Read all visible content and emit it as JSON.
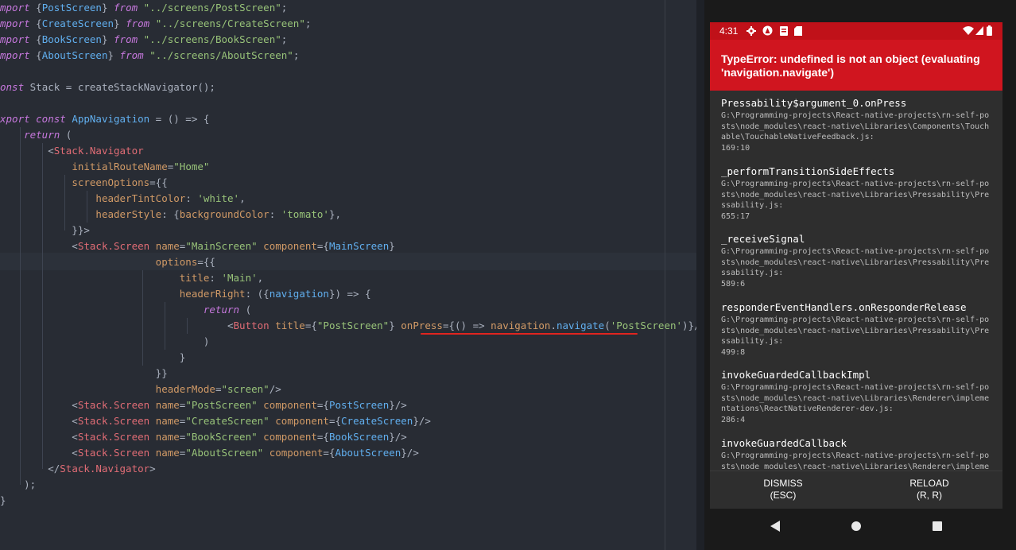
{
  "editor": {
    "lines": [
      [
        [
          "mport ",
          "kw"
        ],
        [
          "{",
          "br"
        ],
        [
          "PostScreen",
          "cl"
        ],
        [
          "} ",
          "br"
        ],
        [
          "from ",
          "kw"
        ],
        [
          "\"../screens/PostScreen\"",
          "str"
        ],
        [
          ";",
          "plain"
        ]
      ],
      [
        [
          "mport ",
          "kw"
        ],
        [
          "{",
          "br"
        ],
        [
          "CreateScreen",
          "cl"
        ],
        [
          "} ",
          "br"
        ],
        [
          "from ",
          "kw"
        ],
        [
          "\"../screens/CreateScreen\"",
          "str"
        ],
        [
          ";",
          "plain"
        ]
      ],
      [
        [
          "mport ",
          "kw"
        ],
        [
          "{",
          "br"
        ],
        [
          "BookScreen",
          "cl"
        ],
        [
          "} ",
          "br"
        ],
        [
          "from ",
          "kw"
        ],
        [
          "\"../screens/BookScreen\"",
          "str"
        ],
        [
          ";",
          "plain"
        ]
      ],
      [
        [
          "mport ",
          "kw"
        ],
        [
          "{",
          "br"
        ],
        [
          "AboutScreen",
          "cl"
        ],
        [
          "} ",
          "br"
        ],
        [
          "from ",
          "kw"
        ],
        [
          "\"../screens/AboutScreen\"",
          "str"
        ],
        [
          ";",
          "plain"
        ]
      ],
      [],
      [
        [
          "onst ",
          "kw"
        ],
        [
          "Stack = createStackNavigator();",
          "plain"
        ]
      ],
      [],
      [
        [
          "xport ",
          "kw"
        ],
        [
          "const ",
          "kw"
        ],
        [
          "AppNavigation",
          "fn"
        ],
        [
          " = () => {",
          "plain"
        ]
      ],
      [
        [
          "    ",
          "plain"
        ],
        [
          "return ",
          "kw"
        ],
        [
          "(",
          "plain"
        ]
      ],
      [
        [
          "        <",
          "plain"
        ],
        [
          "Stack.Navigator",
          "tag"
        ]
      ],
      [
        [
          "            ",
          "plain"
        ],
        [
          "initialRouteName",
          "attr"
        ],
        [
          "=",
          "plain"
        ],
        [
          "\"Home\"",
          "str"
        ]
      ],
      [
        [
          "            ",
          "plain"
        ],
        [
          "screenOptions",
          "attr"
        ],
        [
          "={{",
          "plain"
        ]
      ],
      [
        [
          "                ",
          "plain"
        ],
        [
          "headerTintColor",
          "attr"
        ],
        [
          ": ",
          "plain"
        ],
        [
          "'white'",
          "str"
        ],
        [
          ",",
          "plain"
        ]
      ],
      [
        [
          "                ",
          "plain"
        ],
        [
          "headerStyle",
          "attr"
        ],
        [
          ": {",
          "plain"
        ],
        [
          "backgroundColor",
          "attr"
        ],
        [
          ": ",
          "plain"
        ],
        [
          "'tomato'",
          "str"
        ],
        [
          "},",
          "plain"
        ]
      ],
      [
        [
          "            }}>",
          "plain"
        ]
      ],
      [
        [
          "            <",
          "plain"
        ],
        [
          "Stack.Screen ",
          "tag"
        ],
        [
          "name",
          "attr"
        ],
        [
          "=",
          "plain"
        ],
        [
          "\"MainScreen\" ",
          "str"
        ],
        [
          "component",
          "attr"
        ],
        [
          "={",
          "plain"
        ],
        [
          "MainScreen",
          "cl"
        ],
        [
          "}",
          "plain"
        ]
      ],
      [
        [
          "                          ",
          "plain"
        ],
        [
          "options",
          "attr"
        ],
        [
          "={{",
          "plain"
        ]
      ],
      [
        [
          "                              ",
          "plain"
        ],
        [
          "title",
          "attr"
        ],
        [
          ": ",
          "plain"
        ],
        [
          "'Main'",
          "str"
        ],
        [
          ",",
          "plain"
        ]
      ],
      [
        [
          "                              ",
          "plain"
        ],
        [
          "headerRight",
          "attr"
        ],
        [
          ": ({",
          "plain"
        ],
        [
          "navigation",
          "cl"
        ],
        [
          "}) => {",
          "plain"
        ]
      ],
      [
        [
          "                                  ",
          "plain"
        ],
        [
          "return ",
          "kw"
        ],
        [
          "(",
          "plain"
        ]
      ],
      [
        [
          "                                      <",
          "plain"
        ],
        [
          "Button ",
          "tag"
        ],
        [
          "title",
          "attr"
        ],
        [
          "={",
          "plain"
        ],
        [
          "\"PostScreen\"",
          "str"
        ],
        [
          "} ",
          "plain"
        ],
        [
          "onPress",
          "attr"
        ],
        [
          "={",
          "plain"
        ],
        [
          "() => ",
          "plain"
        ],
        [
          "navigation",
          "attr"
        ],
        [
          ".",
          "plain"
        ],
        [
          "navigate",
          "fn"
        ],
        [
          "(",
          "plain"
        ],
        [
          "'PostScreen'",
          "str"
        ],
        [
          ")}/>",
          "plain"
        ]
      ],
      [
        [
          "                                  )",
          "plain"
        ]
      ],
      [
        [
          "                              }",
          "plain"
        ]
      ],
      [
        [
          "                          }}",
          "plain"
        ]
      ],
      [
        [
          "                          ",
          "plain"
        ],
        [
          "headerMode",
          "attr"
        ],
        [
          "=",
          "plain"
        ],
        [
          "\"screen\"",
          "str"
        ],
        [
          "/>",
          "plain"
        ]
      ],
      [
        [
          "            <",
          "plain"
        ],
        [
          "Stack.Screen ",
          "tag"
        ],
        [
          "name",
          "attr"
        ],
        [
          "=",
          "plain"
        ],
        [
          "\"PostScreen\" ",
          "str"
        ],
        [
          "component",
          "attr"
        ],
        [
          "={",
          "plain"
        ],
        [
          "PostScreen",
          "cl"
        ],
        [
          "}/>",
          "plain"
        ]
      ],
      [
        [
          "            <",
          "plain"
        ],
        [
          "Stack.Screen ",
          "tag"
        ],
        [
          "name",
          "attr"
        ],
        [
          "=",
          "plain"
        ],
        [
          "\"CreateScreen\" ",
          "str"
        ],
        [
          "component",
          "attr"
        ],
        [
          "={",
          "plain"
        ],
        [
          "CreateScreen",
          "cl"
        ],
        [
          "}/>",
          "plain"
        ]
      ],
      [
        [
          "            <",
          "plain"
        ],
        [
          "Stack.Screen ",
          "tag"
        ],
        [
          "name",
          "attr"
        ],
        [
          "=",
          "plain"
        ],
        [
          "\"BookScreen\" ",
          "str"
        ],
        [
          "component",
          "attr"
        ],
        [
          "={",
          "plain"
        ],
        [
          "BookScreen",
          "cl"
        ],
        [
          "}/>",
          "plain"
        ]
      ],
      [
        [
          "            <",
          "plain"
        ],
        [
          "Stack.Screen ",
          "tag"
        ],
        [
          "name",
          "attr"
        ],
        [
          "=",
          "plain"
        ],
        [
          "\"AboutScreen\" ",
          "str"
        ],
        [
          "component",
          "attr"
        ],
        [
          "={",
          "plain"
        ],
        [
          "AboutScreen",
          "cl"
        ],
        [
          "}/>",
          "plain"
        ]
      ],
      [
        [
          "        </",
          "plain"
        ],
        [
          "Stack.Navigator",
          "tag"
        ],
        [
          ">",
          "plain"
        ]
      ],
      [
        [
          "    );",
          "plain"
        ]
      ],
      [
        [
          "}",
          "plain"
        ]
      ]
    ]
  },
  "phone": {
    "status_time": "4:31",
    "error_title": "TypeError: undefined is not an object (evaluating 'navigation.navigate')",
    "frames": [
      {
        "name": "Pressability$argument_0.onPress",
        "path": "G:\\Programming-projects\\React-native-projects\\rn-self-posts\\node_modules\\react-native\\Libraries\\Components\\Touchable\\TouchableNativeFeedback.js:\n169:10"
      },
      {
        "name": "_performTransitionSideEffects",
        "path": "G:\\Programming-projects\\React-native-projects\\rn-self-posts\\node_modules\\react-native\\Libraries\\Pressability\\Pressability.js:\n655:17"
      },
      {
        "name": "_receiveSignal",
        "path": "G:\\Programming-projects\\React-native-projects\\rn-self-posts\\node_modules\\react-native\\Libraries\\Pressability\\Pressability.js:\n589:6"
      },
      {
        "name": "responderEventHandlers.onResponderRelease",
        "path": "G:\\Programming-projects\\React-native-projects\\rn-self-posts\\node_modules\\react-native\\Libraries\\Pressability\\Pressability.js:\n499:8"
      },
      {
        "name": "invokeGuardedCallbackImpl",
        "path": "G:\\Programming-projects\\React-native-projects\\rn-self-posts\\node_modules\\react-native\\Libraries\\Renderer\\implementations\\ReactNativeRenderer-dev.js:\n286:4"
      },
      {
        "name": "invokeGuardedCallback",
        "path": "G:\\Programming-projects\\React-native-projects\\rn-self-posts\\node_modules\\react-native\\Libraries\\Renderer\\implementations\\ReactNativeRenderer-dev.js:"
      }
    ],
    "dismiss_label": "DISMISS",
    "dismiss_hint": "(ESC)",
    "reload_label": "RELOAD",
    "reload_hint": "(R, R)"
  }
}
